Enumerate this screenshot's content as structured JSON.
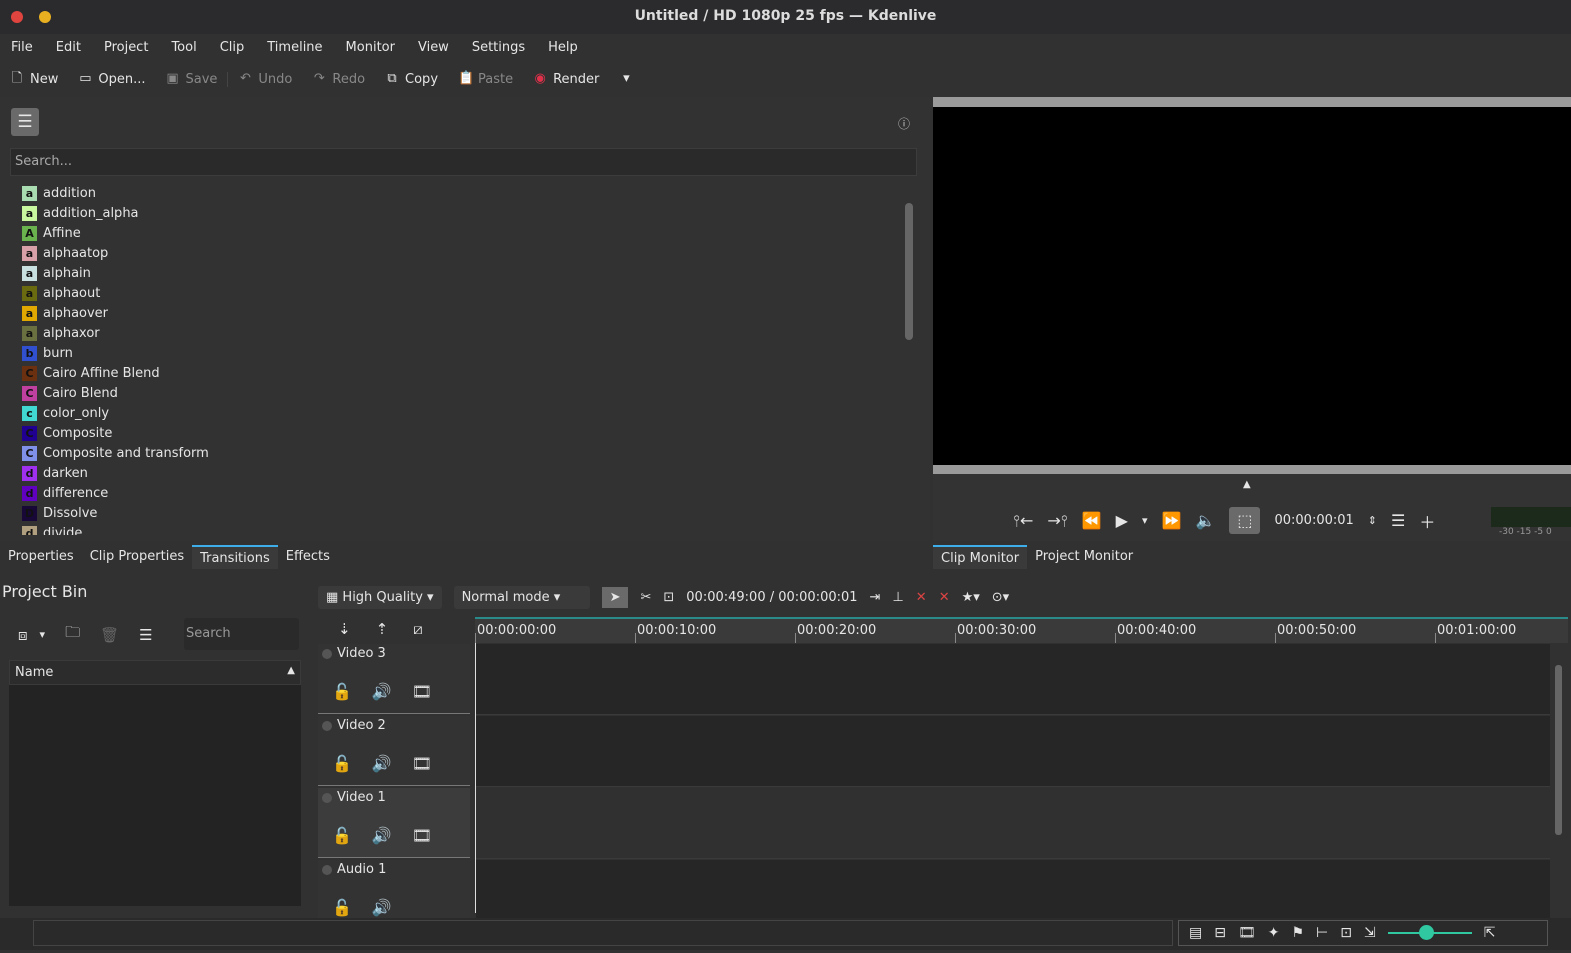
{
  "window": {
    "title": "Untitled / HD 1080p 25 fps — Kdenlive"
  },
  "menu": [
    "File",
    "Edit",
    "Project",
    "Tool",
    "Clip",
    "Timeline",
    "Monitor",
    "View",
    "Settings",
    "Help"
  ],
  "toolbar": {
    "new": "New",
    "open": "Open...",
    "save": "Save",
    "undo": "Undo",
    "redo": "Redo",
    "copy": "Copy",
    "paste": "Paste",
    "render": "Render"
  },
  "transitions": {
    "search_placeholder": "Search...",
    "items": [
      {
        "label": "addition",
        "letter": "a",
        "color": "#a9dcb0"
      },
      {
        "label": "addition_alpha",
        "letter": "a",
        "color": "#c8f7a0"
      },
      {
        "label": "Affine",
        "letter": "A",
        "color": "#6ab24e"
      },
      {
        "label": "alphaatop",
        "letter": "a",
        "color": "#d8a0a8"
      },
      {
        "label": "alphain",
        "letter": "a",
        "color": "#c8e0e0"
      },
      {
        "label": "alphaout",
        "letter": "a",
        "color": "#6a6a10"
      },
      {
        "label": "alphaover",
        "letter": "a",
        "color": "#e0a800"
      },
      {
        "label": "alphaxor",
        "letter": "a",
        "color": "#6a7040"
      },
      {
        "label": "burn",
        "letter": "b",
        "color": "#3050d0"
      },
      {
        "label": "Cairo Affine Blend",
        "letter": "C",
        "color": "#6a3010"
      },
      {
        "label": "Cairo Blend",
        "letter": "C",
        "color": "#c040a0"
      },
      {
        "label": "color_only",
        "letter": "c",
        "color": "#40d8d0"
      },
      {
        "label": "Composite",
        "letter": "C",
        "color": "#200090"
      },
      {
        "label": "Composite and transform",
        "letter": "C",
        "color": "#8090e8"
      },
      {
        "label": "darken",
        "letter": "d",
        "color": "#a030f0"
      },
      {
        "label": "difference",
        "letter": "d",
        "color": "#6000c0"
      },
      {
        "label": "Dissolve",
        "letter": "D",
        "color": "#180838"
      },
      {
        "label": "divide",
        "letter": "d",
        "color": "#b0a080"
      }
    ]
  },
  "monitor": {
    "timecode": "00:00:00:01",
    "meter_scale": "-30 -15  -5  0"
  },
  "tabs_left": [
    {
      "label": "Properties"
    },
    {
      "label": "Clip Properties"
    },
    {
      "label": "Transitions",
      "active": true
    },
    {
      "label": "Effects"
    }
  ],
  "tabs_right": [
    {
      "label": "Clip Monitor",
      "active": true
    },
    {
      "label": "Project Monitor"
    }
  ],
  "bin": {
    "title": "Project Bin",
    "search_placeholder": "Search",
    "column": "Name"
  },
  "timeline": {
    "quality": "High Quality",
    "mode": "Normal mode",
    "position": "00:00:49:00 / 00:00:00:01",
    "ruler": [
      "00:00:00:00",
      "00:00:10:00",
      "00:00:20:00",
      "00:00:30:00",
      "00:00:40:00",
      "00:00:50:00",
      "00:01:00:00"
    ],
    "tracks": [
      {
        "name": "Video 3",
        "type": "video"
      },
      {
        "name": "Video 2",
        "type": "video"
      },
      {
        "name": "Video 1",
        "type": "video",
        "active": true
      },
      {
        "name": "Audio 1",
        "type": "audio"
      }
    ]
  },
  "status": {
    "zoom_level": 0.45
  },
  "colors": {
    "accent": "#3daee9",
    "zoom": "#2fc8a0",
    "render": "#e0304a"
  }
}
